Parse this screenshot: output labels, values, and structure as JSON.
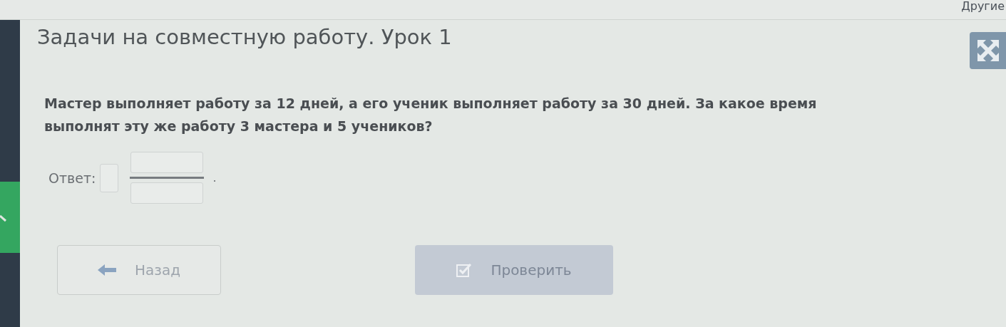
{
  "top_link": "Другие",
  "title": "Задачи на совместную работу. Урок 1",
  "question": "Мастер выполняет работу за 12 дней, а его ученик выполняет работу за 30 дней. За какое время выполнят эту же работу 3 мастера и 5 учеников?",
  "answer": {
    "label": "Ответ:",
    "suffix": "."
  },
  "buttons": [
    {
      "kind": "back",
      "label": "Назад",
      "disabled": false
    },
    {
      "kind": "check",
      "label": "Проверить",
      "disabled": true
    }
  ]
}
